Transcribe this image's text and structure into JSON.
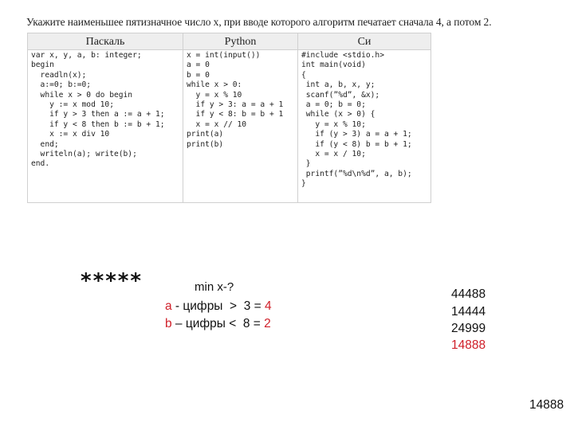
{
  "task": {
    "text": "Укажите наименьшее пятизначное число x, при вводе которого алгоритм печатает сначала 4, а потом 2."
  },
  "table": {
    "headers": [
      "Паскаль",
      "Python",
      "Си"
    ],
    "code": {
      "pascal": "var x, y, a, b: integer;\nbegin\n  readln(x);\n  a:=0; b:=0;\n  while x > 0 do begin\n    y := x mod 10;\n    if y > 3 then a := a + 1;\n    if y < 8 then b := b + 1;\n    x := x div 10\n  end;\n  writeln(a); write(b);\nend.",
      "python": "x = int(input())\na = 0\nb = 0\nwhile x > 0:\n  y = x % 10\n  if y > 3: a = a + 1\n  if y < 8: b = b + 1\n  x = x // 10\nprint(a)\nprint(b)",
      "c": "#include <stdio.h>\nint main(void)\n{\n int a, b, x, y;\n scanf(”%d”, &x);\n a = 0; b = 0;\n while (x > 0) {\n   y = x % 10;\n   if (y > 3) a = a + 1;\n   if (y < 8) b = b + 1;\n   x = x / 10;\n }\n printf(”%d\\n%d”, a, b);\n}"
    }
  },
  "notes": {
    "stars": "*****",
    "min_question": "min x-?",
    "cond_a": {
      "var": "a",
      "text": " - цифры  >  3 = ",
      "value": "4"
    },
    "cond_b": {
      "var": "b",
      "text": " – цифры <  8 = ",
      "value": "2"
    }
  },
  "candidates": [
    "44488",
    "14444",
    "24999",
    "14888"
  ],
  "highlighted_candidate_color": "#d0202a",
  "answer": "14888"
}
